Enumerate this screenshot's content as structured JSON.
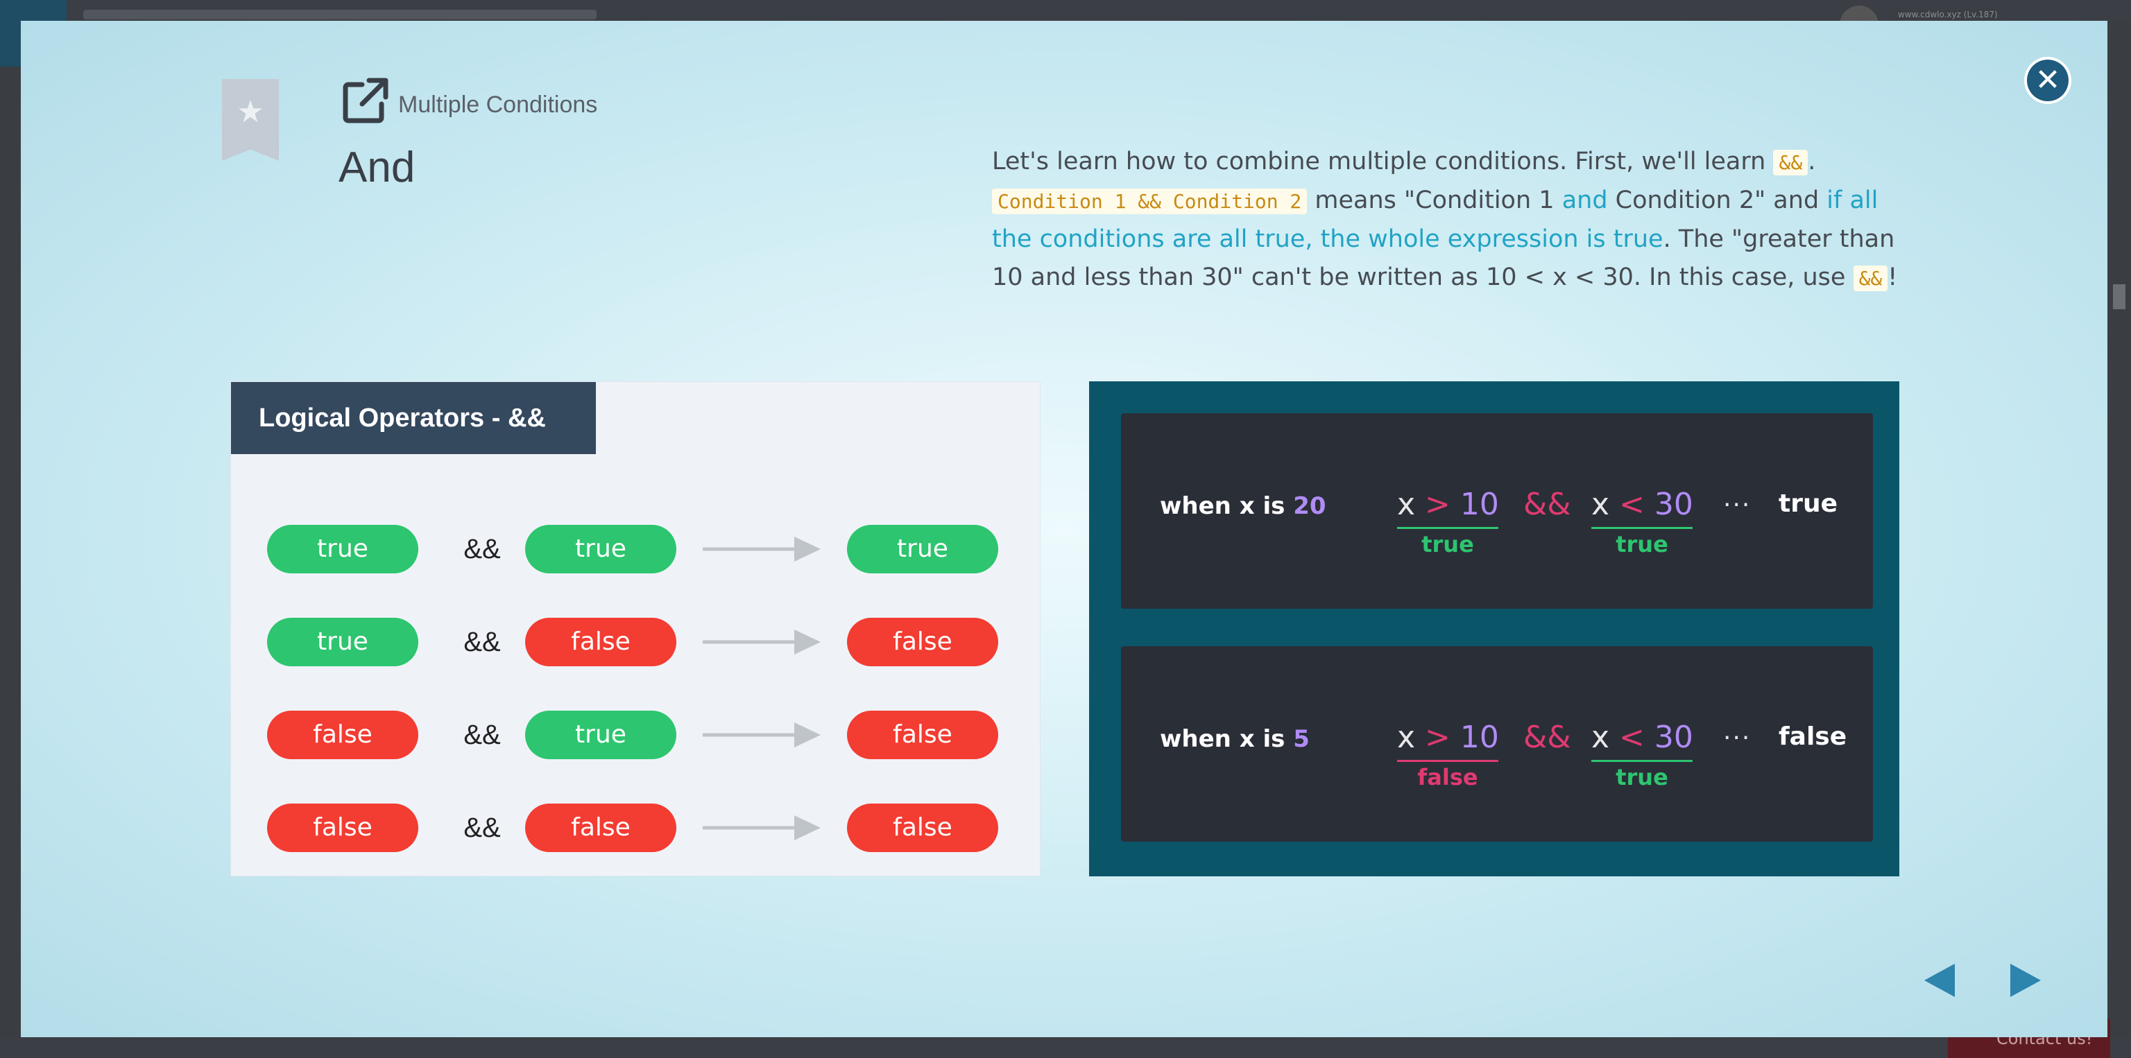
{
  "background_app": {
    "user_text": "www.cdwlo.xyz (Lv.187)",
    "contact_label": "Contact us!"
  },
  "lesson": {
    "subtitle": "Multiple Conditions",
    "title": "And",
    "description": {
      "t1": "Let's learn how to combine multiple conditions. First, we'll learn ",
      "c1": "&&",
      "t2": ".",
      "c2": "Condition 1 && Condition 2",
      "t3": " means \"Condition 1 ",
      "h1": "and",
      "t4": " Condition 2\" and ",
      "h2": "if all the conditions are all true, the whole expression is true",
      "t5": ". The \"greater than 10 and less than 30\" can't be written as 10 < x < 30. In this case, use ",
      "c3": "&&",
      "t6": "!"
    }
  },
  "truth_table": {
    "header": "Logical Operators - &&",
    "operator": "&&",
    "rows": [
      {
        "a": "true",
        "b": "true",
        "result": "true"
      },
      {
        "a": "true",
        "b": "false",
        "result": "false"
      },
      {
        "a": "false",
        "b": "true",
        "result": "false"
      },
      {
        "a": "false",
        "b": "false",
        "result": "false"
      }
    ]
  },
  "examples": [
    {
      "when_prefix": "when x is ",
      "x_value": "20",
      "left_var": "x",
      "left_op": ">",
      "left_num": "10",
      "and_op": "&&",
      "right_var": "x",
      "right_op": "<",
      "right_num": "30",
      "left_result": "true",
      "right_result": "true",
      "dots": "···",
      "result": "true"
    },
    {
      "when_prefix": "when x is ",
      "x_value": "5",
      "left_var": "x",
      "left_op": ">",
      "left_num": "10",
      "and_op": "&&",
      "right_var": "x",
      "right_op": "<",
      "right_num": "30",
      "left_result": "false",
      "right_result": "true",
      "dots": "···",
      "result": "false"
    }
  ],
  "colors": {
    "true_green": "#2dc56f",
    "false_red": "#f33c32",
    "highlight_blue": "#21a3c4",
    "code_orange": "#c88a12",
    "dark_teal": "#0b5569",
    "navy": "#34485e"
  },
  "icons": {
    "close": "close-icon",
    "bookmark": "bookmark-star-icon",
    "external": "external-link-icon",
    "prev": "prev-arrow-icon",
    "next": "next-arrow-icon"
  }
}
